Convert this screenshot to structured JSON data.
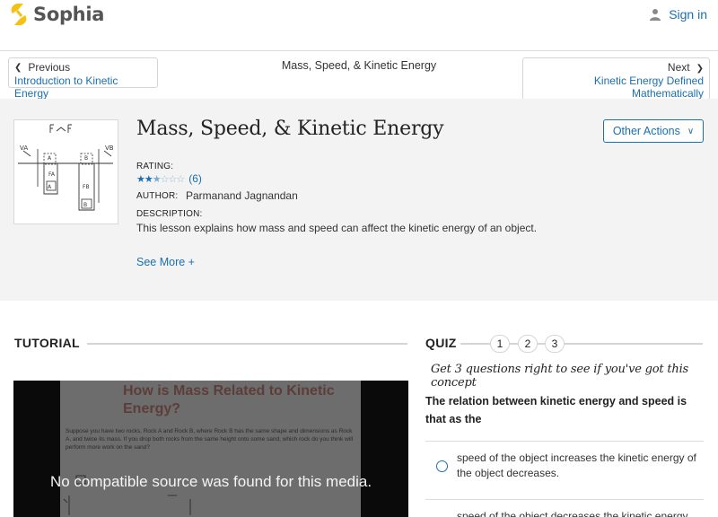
{
  "header": {
    "logo_text": "Sophia",
    "signin_label": "Sign in",
    "brand_color": "#f3c213"
  },
  "nav": {
    "previous_label": "Previous",
    "previous_link": "Introduction to Kinetic Energy",
    "title": "Mass, Speed, & Kinetic Energy",
    "next_label": "Next",
    "next_link": "Kinetic Energy Defined Mathematically"
  },
  "lesson": {
    "title": "Mass, Speed, & Kinetic Energy",
    "other_actions_label": "Other Actions",
    "rating_label": "RATING:",
    "rating_stars": 2.5,
    "rating_count": "(6)",
    "author_label": "AUTHOR:",
    "author_name": "Parmanand Jagnandan",
    "description_label": "DESCRIPTION:",
    "description": "This lesson explains how mass and speed can affect the kinetic energy of an object.",
    "see_more_label": "See More +"
  },
  "tutorial": {
    "heading": "TUTORIAL",
    "slide_title": "How is Mass Related to Kinetic Energy?",
    "slide_text": "Suppose you have two rocks, Rock A and Rock B, where Rock B has the same shape and dimensions as Rock A, and twice its mass. If you drop both rocks from the same height onto some sand, which rock do you think will perform more work on the sand?",
    "no_source_message": "No compatible source was found for this media."
  },
  "quiz": {
    "heading": "QUIZ",
    "numbers": [
      "1",
      "2",
      "3"
    ],
    "note": "Get 3 questions right to see if you've got this concept",
    "question": "The relation between kinetic energy and speed is that as the",
    "answers": [
      "speed of the object increases the kinetic energy of the object decreases.",
      "speed of the object decreases the kinetic energy"
    ]
  },
  "colors": {
    "link_blue": "#1a6fb1",
    "lesson_bg": "#f3f3f3"
  }
}
